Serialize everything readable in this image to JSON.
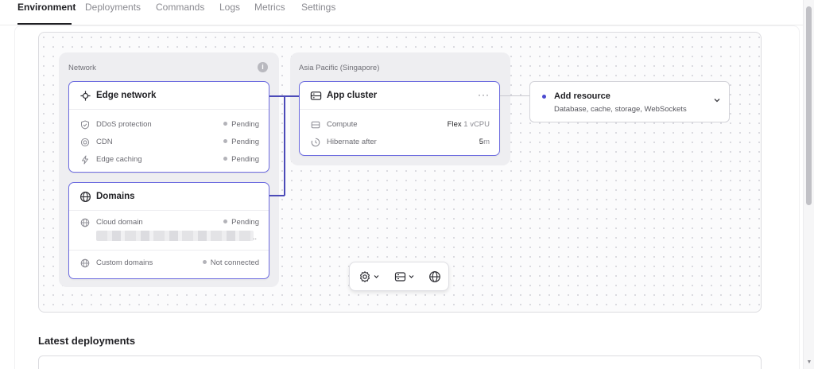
{
  "tabs": [
    {
      "label": "Environment",
      "active": true
    },
    {
      "label": "Deployments"
    },
    {
      "label": "Commands"
    },
    {
      "label": "Logs"
    },
    {
      "label": "Metrics"
    },
    {
      "label": "Settings"
    }
  ],
  "network_group": {
    "label": "Network",
    "info_icon": "i",
    "edge_card": {
      "title": "Edge network",
      "icon": "edge-network-icon",
      "rows": [
        {
          "icon": "shield-icon",
          "label": "DDoS protection",
          "value": "Pending"
        },
        {
          "icon": "cdn-icon",
          "label": "CDN",
          "value": "Pending"
        },
        {
          "icon": "lightning-icon",
          "label": "Edge caching",
          "value": "Pending"
        }
      ]
    },
    "domains_card": {
      "title": "Domains",
      "icon": "globe-icon",
      "cloud_label": "Cloud domain",
      "cloud_value": "Pending",
      "cloud_truncation": "..",
      "custom_label": "Custom domains",
      "custom_value": "Not connected"
    }
  },
  "region_group": {
    "label": "Asia Pacific (Singapore)",
    "app_card": {
      "title": "App cluster",
      "more": "···",
      "compute_label": "Compute",
      "compute_value_strong": "Flex",
      "compute_value_muted": "1 vCPU",
      "hibernate_label": "Hibernate after",
      "hibernate_value_strong": "5",
      "hibernate_value_muted": "m"
    }
  },
  "add_resource": {
    "title": "Add resource",
    "subtitle": "Database, cache, storage, WebSockets"
  },
  "toolbar": {
    "items": [
      "settings-icon",
      "server-icon",
      "globe-icon"
    ]
  },
  "latest": {
    "title": "Latest deployments"
  },
  "colors": {
    "accent": "#6d6ce0",
    "wire": "#4c4bb8",
    "canvas": "#fbfbfc"
  }
}
